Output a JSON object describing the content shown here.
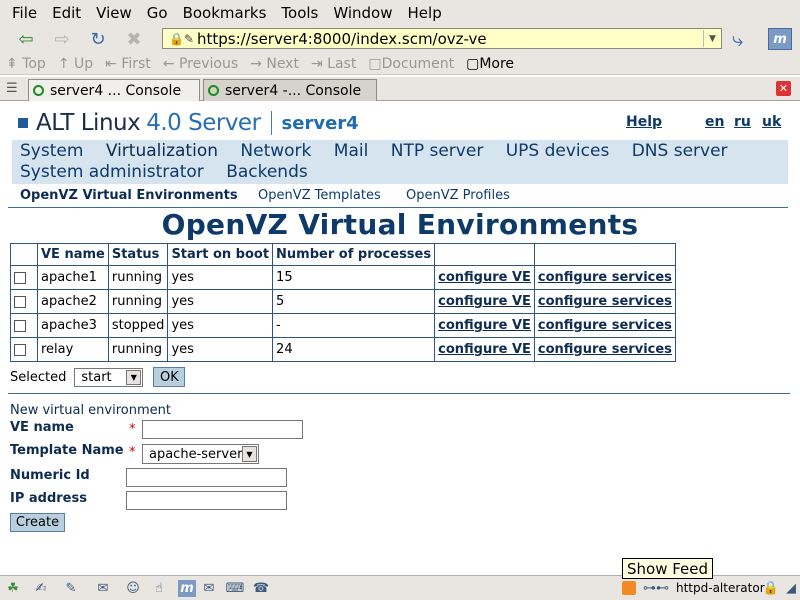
{
  "menu": [
    "File",
    "Edit",
    "View",
    "Go",
    "Bookmarks",
    "Tools",
    "Window",
    "Help"
  ],
  "address": {
    "url": "https://server4:8000/index.scm/ovz-ve"
  },
  "linkbar": [
    "Top",
    "Up",
    "First",
    "Previous",
    "Next",
    "Last",
    "Document",
    "More"
  ],
  "tabs": [
    "server4 ... Console",
    "server4 -... Console"
  ],
  "brand": {
    "name": "ALT Linux",
    "version": "4.0 Server",
    "host": "server4"
  },
  "toplinks": {
    "help": "Help",
    "en": "en",
    "ru": "ru",
    "uk": "uk"
  },
  "nav": {
    "row1": [
      "System",
      "Virtualization",
      "Network",
      "Mail",
      "NTP server",
      "UPS devices",
      "DNS server"
    ],
    "row2": [
      "System administrator",
      "Backends"
    ]
  },
  "subnav": [
    "OpenVZ Virtual Environments",
    "OpenVZ Templates",
    "OpenVZ Profiles"
  ],
  "page_title": "OpenVZ Virtual Environments",
  "table": {
    "headers": [
      "VE name",
      "Status",
      "Start on boot",
      "Number of processes"
    ],
    "rows": [
      {
        "name": "apache1",
        "status": "running",
        "boot": "yes",
        "procs": "15",
        "cfg": "configure VE",
        "svc": "configure services"
      },
      {
        "name": "apache2",
        "status": "running",
        "boot": "yes",
        "procs": "5",
        "cfg": "configure VE",
        "svc": "configure services"
      },
      {
        "name": "apache3",
        "status": "stopped",
        "boot": "yes",
        "procs": "-",
        "cfg": "configure VE",
        "svc": "configure services"
      },
      {
        "name": "relay",
        "status": "running",
        "boot": "yes",
        "procs": "24",
        "cfg": "configure VE",
        "svc": "configure services"
      }
    ]
  },
  "selected": {
    "label": "Selected",
    "value": "start",
    "ok": "OK"
  },
  "form": {
    "title": "New virtual environment",
    "ve_name": "VE name",
    "template_name": "Template Name",
    "template_value": "apache-server",
    "numeric_id": "Numeric Id",
    "ip_address": "IP address",
    "required_mark": "*",
    "create": "Create"
  },
  "tooltip": "Show Feed",
  "status": {
    "text": "httpd-alterator"
  },
  "colors": {
    "accent": "#0e3a6a",
    "nav_bg": "#d5e4ef",
    "url_bg": "#ffffc6",
    "button_bg": "#b8cfe0"
  }
}
